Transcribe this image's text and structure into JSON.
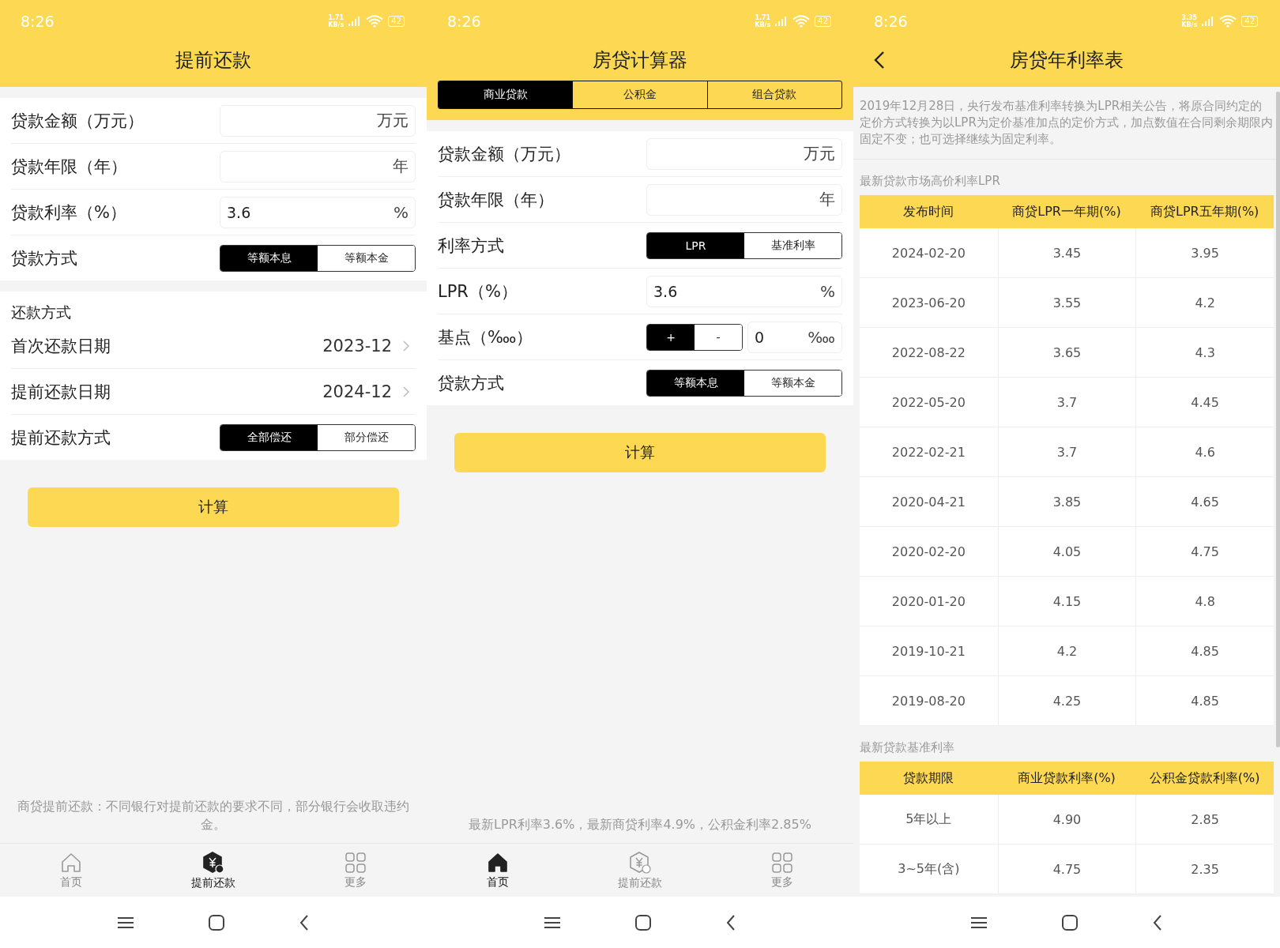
{
  "screens": [
    {
      "kind": "form",
      "status_bar": {
        "time": "8:26",
        "speed_value": "1.71",
        "speed_unit": "KB/s",
        "battery": "42"
      },
      "header": {
        "title": "提前还款"
      },
      "groups": [
        {
          "rows": [
            {
              "kind": "field",
              "label": "贷款金额（万元）",
              "unit": "万元"
            },
            {
              "kind": "field",
              "label": "贷款年限（年）",
              "unit": "年"
            },
            {
              "kind": "field",
              "label": "贷款利率（%）",
              "value": "3.6",
              "unit": "%"
            },
            {
              "kind": "segmented",
              "label": "贷款方式",
              "options": [
                {
                  "label": "等额本息",
                  "selected": true
                },
                {
                  "label": "等额本金",
                  "selected": false
                }
              ]
            }
          ]
        },
        {
          "heading": "还款方式",
          "rows": [
            {
              "kind": "picker",
              "label": "首次还款日期",
              "value": "2023-12"
            },
            {
              "kind": "picker",
              "label": "提前还款日期",
              "value": "2024-12"
            },
            {
              "kind": "segmented",
              "label": "提前还款方式",
              "options": [
                {
                  "label": "全部偿还",
                  "selected": true
                },
                {
                  "label": "部分偿还",
                  "selected": false
                }
              ]
            }
          ]
        }
      ],
      "button": "计算",
      "footnote": "商贷提前还款：不同银行对提前还款的要求不同，部分银行会收取违约金。",
      "tab_bar": [
        {
          "label": "首页",
          "selected": false
        },
        {
          "label": "提前还款",
          "selected": true
        },
        {
          "label": "更多",
          "selected": false
        }
      ]
    },
    {
      "kind": "form",
      "status_bar": {
        "time": "8:26",
        "speed_value": "1.71",
        "speed_unit": "KB/s",
        "battery": "42"
      },
      "header": {
        "title": "房贷计算器"
      },
      "tabs": [
        {
          "label": "商业贷款",
          "selected": true
        },
        {
          "label": "公积金",
          "selected": false
        },
        {
          "label": "组合贷款",
          "selected": false
        }
      ],
      "groups": [
        {
          "rows": [
            {
              "kind": "field",
              "label": "贷款金额（万元）",
              "unit": "万元"
            },
            {
              "kind": "field",
              "label": "贷款年限（年）",
              "unit": "年"
            },
            {
              "kind": "segmented",
              "label": "利率方式",
              "options": [
                {
                  "label": "LPR",
                  "selected": true
                },
                {
                  "label": "基准利率",
                  "selected": false
                }
              ]
            },
            {
              "kind": "field",
              "label": "LPR（%）",
              "value": "3.6",
              "unit": "%"
            },
            {
              "kind": "stepper",
              "label": "基点（‱）",
              "options": [
                {
                  "label": "+",
                  "selected": true
                },
                {
                  "label": "-",
                  "selected": false
                }
              ],
              "value": "0",
              "unit": "‱"
            },
            {
              "kind": "segmented",
              "label": "贷款方式",
              "options": [
                {
                  "label": "等额本息",
                  "selected": true
                },
                {
                  "label": "等额本金",
                  "selected": false
                }
              ]
            }
          ]
        }
      ],
      "button": "计算",
      "footnote": "最新LPR利率3.6%，最新商贷利率4.9%，公积金利率2.85%",
      "tab_bar": [
        {
          "label": "首页",
          "selected": true
        },
        {
          "label": "提前还款",
          "selected": false
        },
        {
          "label": "更多",
          "selected": false
        }
      ]
    },
    {
      "kind": "table",
      "status_bar": {
        "time": "8:26",
        "speed_value": "3.35",
        "speed_unit": "KB/s",
        "battery": "42"
      },
      "header": {
        "title": "房贷年利率表",
        "back": true
      },
      "intro": "2019年12月28日，央行发布基准利率转换为LPR相关公告，将原合同约定的定价方式转换为以LPR为定价基准加点的定价方式，加点数值在合同剩余期限内固定不变；也可选择继续为固定利率。",
      "tables": [
        {
          "heading": "最新贷款市场高价利率LPR",
          "columns": [
            "发布时间",
            "商贷LPR一年期(%)",
            "商贷LPR五年期(%)"
          ],
          "rows": [
            [
              "2024-02-20",
              "3.45",
              "3.95"
            ],
            [
              "2023-06-20",
              "3.55",
              "4.2"
            ],
            [
              "2022-08-22",
              "3.65",
              "4.3"
            ],
            [
              "2022-05-20",
              "3.7",
              "4.45"
            ],
            [
              "2022-02-21",
              "3.7",
              "4.6"
            ],
            [
              "2020-04-21",
              "3.85",
              "4.65"
            ],
            [
              "2020-02-20",
              "4.05",
              "4.75"
            ],
            [
              "2020-01-20",
              "4.15",
              "4.8"
            ],
            [
              "2019-10-21",
              "4.2",
              "4.85"
            ],
            [
              "2019-08-20",
              "4.25",
              "4.85"
            ]
          ]
        },
        {
          "heading": "最新贷款基准利率",
          "columns": [
            "贷款期限",
            "商业贷款利率(%)",
            "公积金贷款利率(%)"
          ],
          "rows": [
            [
              "5年以上",
              "4.90",
              "2.85"
            ],
            [
              "3~5年(含)",
              "4.75",
              "2.35"
            ]
          ]
        }
      ]
    }
  ]
}
